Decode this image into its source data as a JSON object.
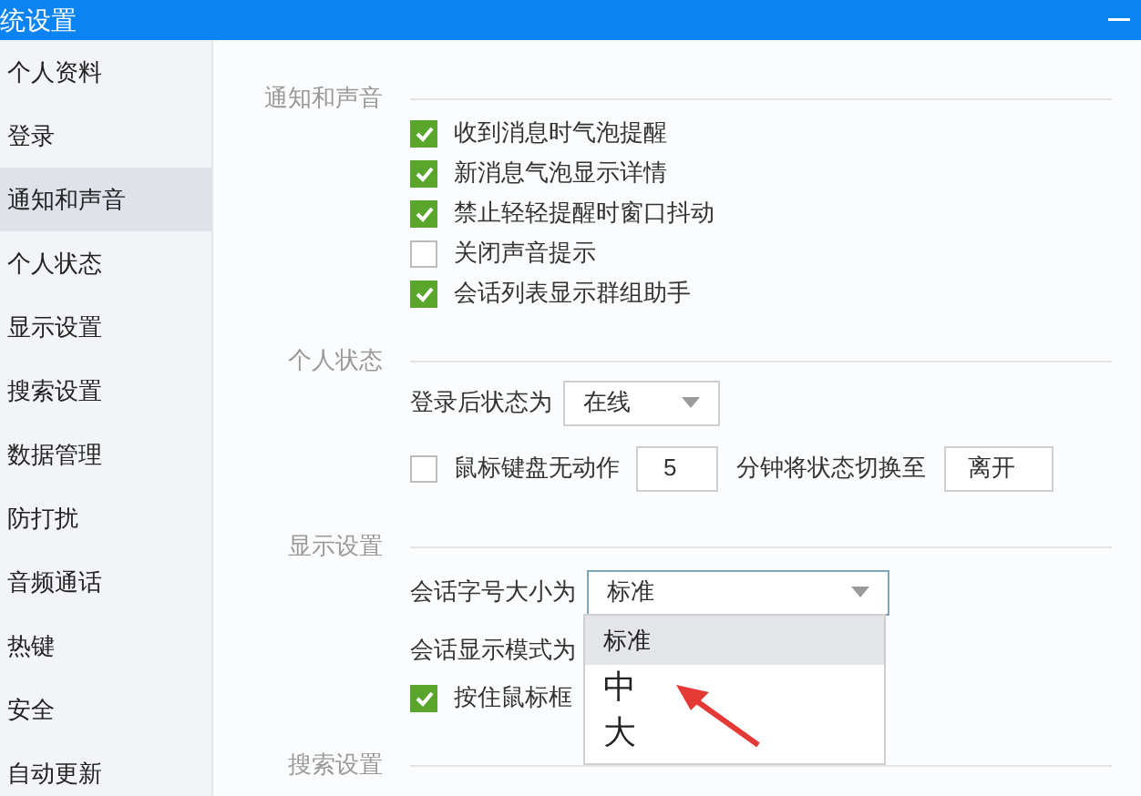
{
  "window": {
    "title": "统设置"
  },
  "sidebar": {
    "items": [
      {
        "label": "个人资料",
        "selected": false
      },
      {
        "label": "登录",
        "selected": false
      },
      {
        "label": "通知和声音",
        "selected": true
      },
      {
        "label": "个人状态",
        "selected": false
      },
      {
        "label": "显示设置",
        "selected": false
      },
      {
        "label": "搜索设置",
        "selected": false
      },
      {
        "label": "数据管理",
        "selected": false
      },
      {
        "label": "防打扰",
        "selected": false
      },
      {
        "label": "音频通话",
        "selected": false
      },
      {
        "label": "热键",
        "selected": false
      },
      {
        "label": "安全",
        "selected": false
      },
      {
        "label": "自动更新",
        "selected": false
      }
    ]
  },
  "sections": [
    {
      "title": "通知和声音",
      "rows": [
        {
          "kind": "checkbox",
          "label": "收到消息时气泡提醒",
          "checked": true
        },
        {
          "kind": "checkbox",
          "label": "新消息气泡显示详情",
          "checked": true
        },
        {
          "kind": "checkbox",
          "label": "禁止轻轻提醒时窗口抖动",
          "checked": true
        },
        {
          "kind": "checkbox",
          "label": "关闭声音提示",
          "checked": false
        },
        {
          "kind": "checkbox",
          "label": "会话列表显示群组助手",
          "checked": true
        }
      ]
    },
    {
      "title": "个人状态",
      "rows": [
        {
          "kind": "select",
          "label": "登录后状态为",
          "value": "在线"
        },
        {
          "kind": "idle",
          "label": "鼠标键盘无动作",
          "checked": false,
          "minutes": "5",
          "suffix": "分钟将状态切换至",
          "status": "离开"
        }
      ]
    },
    {
      "title": "显示设置",
      "rows": [
        {
          "kind": "dropdown",
          "label": "会话字号大小为",
          "value": "标准",
          "options": [
            {
              "label": "标准",
              "selected": true
            },
            {
              "label": "中",
              "selected": false
            },
            {
              "label": "大",
              "selected": false
            }
          ]
        },
        {
          "kind": "text",
          "label": "会话显示模式为"
        },
        {
          "kind": "checkbox",
          "label": "按住鼠标框",
          "checked": true
        }
      ]
    },
    {
      "title": "搜索设置"
    }
  ]
}
